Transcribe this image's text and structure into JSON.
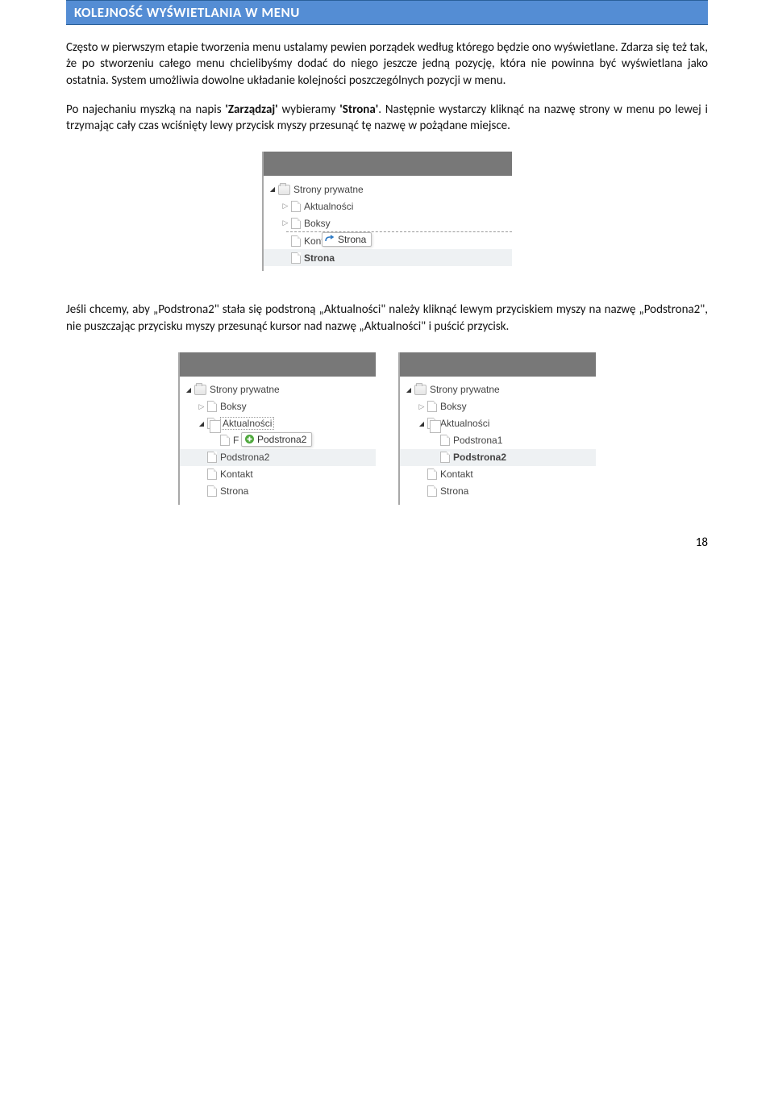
{
  "header": {
    "title": "KOLEJNOŚĆ WYŚWIETLANIA W MENU"
  },
  "paragraphs": {
    "p1": "Często w pierwszym etapie tworzenia menu ustalamy pewien porządek według którego będzie ono wyświetlane. Zdarza się też tak, że po stworzeniu całego menu chcielibyśmy dodać do niego jeszcze jedną pozycję, która nie powinna być wyświetlana jako ostatnia. System umożliwia dowolne układanie kolejności poszczególnych pozycji w menu.",
    "p2a": "Po najechaniu myszką na napis ",
    "p2b": "'Zarządzaj'",
    "p2c": " wybieramy ",
    "p2d": "'Strona'",
    "p2e": ". Następnie wystarczy kliknąć na nazwę strony w menu po lewej i trzymając cały czas wciśnięty lewy przycisk myszy przesunąć tę nazwę w pożądane miejsce.",
    "p3": "Jeśli chcemy, aby „Podstrona2\" stała się podstroną „Aktualności\" należy kliknąć lewym przyciskiem myszy na nazwę „Podstrona2\", nie puszczając przycisku myszy przesunąć kursor nad nazwę „Aktualności\" i puścić przycisk."
  },
  "fig1": {
    "root": "Strony prywatne",
    "items": {
      "aktualnosci": "Aktualności",
      "boksy": "Boksy",
      "kontakt_partial": "Konta",
      "strona": "Strona"
    },
    "drag_hint": "Strona"
  },
  "fig2_left": {
    "root": "Strony prywatne",
    "items": {
      "boksy": "Boksy",
      "aktualnosci": "Aktualności",
      "p_prefix": "F",
      "podstrona2_hint": "Podstrona2",
      "podstrona2": "Podstrona2",
      "kontakt": "Kontakt",
      "strona": "Strona"
    }
  },
  "fig2_right": {
    "root": "Strony prywatne",
    "items": {
      "boksy": "Boksy",
      "aktualnosci": "Aktualności",
      "podstrona1": "Podstrona1",
      "podstrona2": "Podstrona2",
      "kontakt": "Kontakt",
      "strona": "Strona"
    }
  },
  "page_number": "18"
}
